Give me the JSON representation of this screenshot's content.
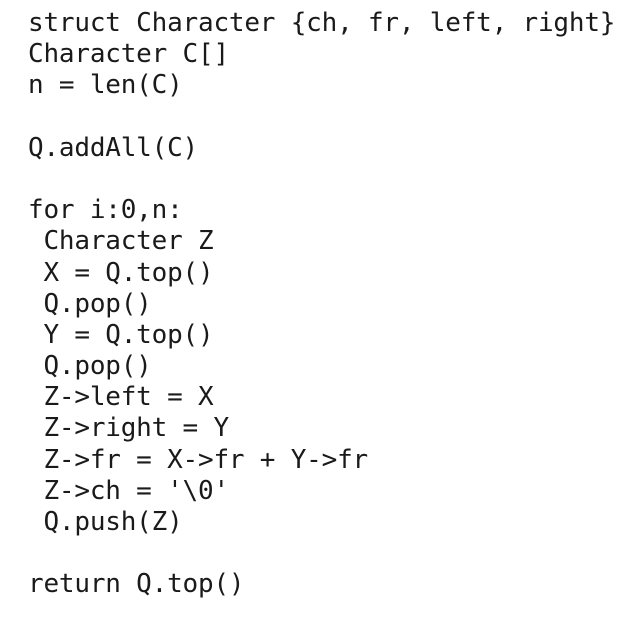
{
  "code": {
    "lines": [
      "struct Character {ch, fr, left, right}",
      "Character C[]",
      "n = len(C)",
      "",
      "Q.addAll(C)",
      "",
      "for i:0,n:",
      " Character Z",
      " X = Q.top()",
      " Q.pop()",
      " Y = Q.top()",
      " Q.pop()",
      " Z->left = X",
      " Z->right = Y",
      " Z->fr = X->fr + Y->fr",
      " Z->ch = '\\0'",
      " Q.push(Z)",
      "",
      "return Q.top()"
    ]
  }
}
